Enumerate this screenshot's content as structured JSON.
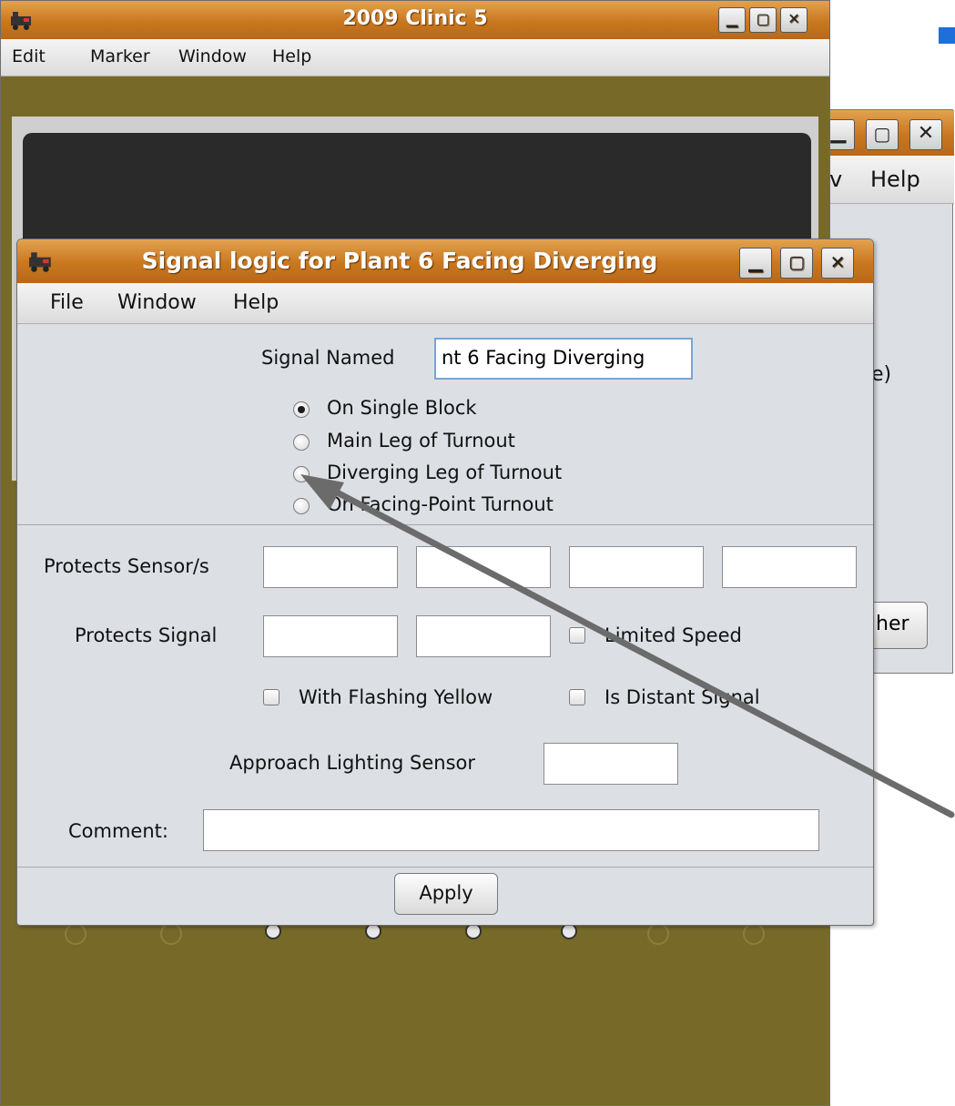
{
  "main_window": {
    "title": "2009 Clinic 5",
    "menu": [
      "Edit",
      "Marker",
      "Window",
      "Help"
    ],
    "accent": "#c9771f"
  },
  "background_window": {
    "menu_help": "Help",
    "fragment_menu": "v",
    "fragment_text": "e)",
    "fragment_button": "her"
  },
  "dialog": {
    "title": "Signal logic for Plant 6 Facing Diverging",
    "menu": [
      "File",
      "Window",
      "Help"
    ],
    "signal_named_label": "Signal Named",
    "signal_named_value": "nt 6 Facing Diverging",
    "modes": [
      {
        "label": "On Single Block",
        "selected": true
      },
      {
        "label": "Main Leg of Turnout",
        "selected": false
      },
      {
        "label": "Diverging Leg of Turnout",
        "selected": false
      },
      {
        "label": "On Facing-Point Turnout",
        "selected": false
      }
    ],
    "protects_sensors_label": "Protects Sensor/s",
    "protects_signal_label": "Protects Signal",
    "limited_speed_label": "Limited Speed",
    "flashing_yellow_label": "With Flashing Yellow",
    "distant_signal_label": "Is Distant Signal",
    "approach_lighting_label": "Approach Lighting Sensor",
    "comment_label": "Comment:",
    "apply_label": "Apply"
  },
  "window_button_icons": [
    "minimize-icon",
    "maximize-icon",
    "close-icon"
  ]
}
